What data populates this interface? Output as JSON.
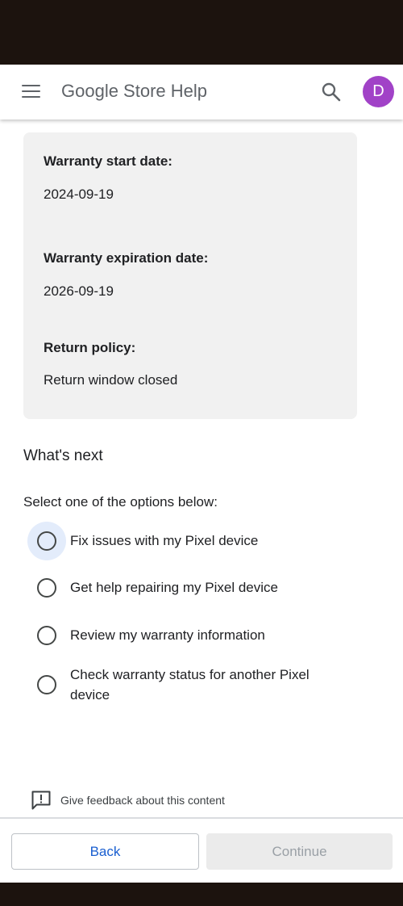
{
  "header": {
    "title": "Google Store Help",
    "menu_icon": "hamburger-menu-icon",
    "search_icon": "search-icon",
    "avatar_initial": "D",
    "avatar_color": "#a142c7"
  },
  "warranty_card": {
    "start_label": "Warranty start date:",
    "start_value": "2024-09-19",
    "expiration_label": "Warranty expiration date:",
    "expiration_value": "2026-09-19",
    "return_label": "Return policy:",
    "return_value": "Return window closed"
  },
  "next_steps": {
    "heading": "What's next",
    "instructions": "Select one of the options below:",
    "options": [
      {
        "label": "Fix issues with my Pixel device",
        "selected": false,
        "focused": true
      },
      {
        "label": "Get help repairing my Pixel device",
        "selected": false,
        "focused": false
      },
      {
        "label": "Review my warranty information",
        "selected": false,
        "focused": false
      },
      {
        "label": "Check warranty status for another Pixel device",
        "selected": false,
        "focused": false
      }
    ]
  },
  "feedback": {
    "icon": "feedback-icon",
    "label": "Give feedback about this content"
  },
  "footer": {
    "back_label": "Back",
    "continue_label": "Continue",
    "continue_enabled": false
  },
  "colors": {
    "accent": "#1a5fd0",
    "focus_highlight": "#e3ecfb",
    "card_background": "#f1f1f1",
    "disabled_button": "#ebebeb"
  }
}
